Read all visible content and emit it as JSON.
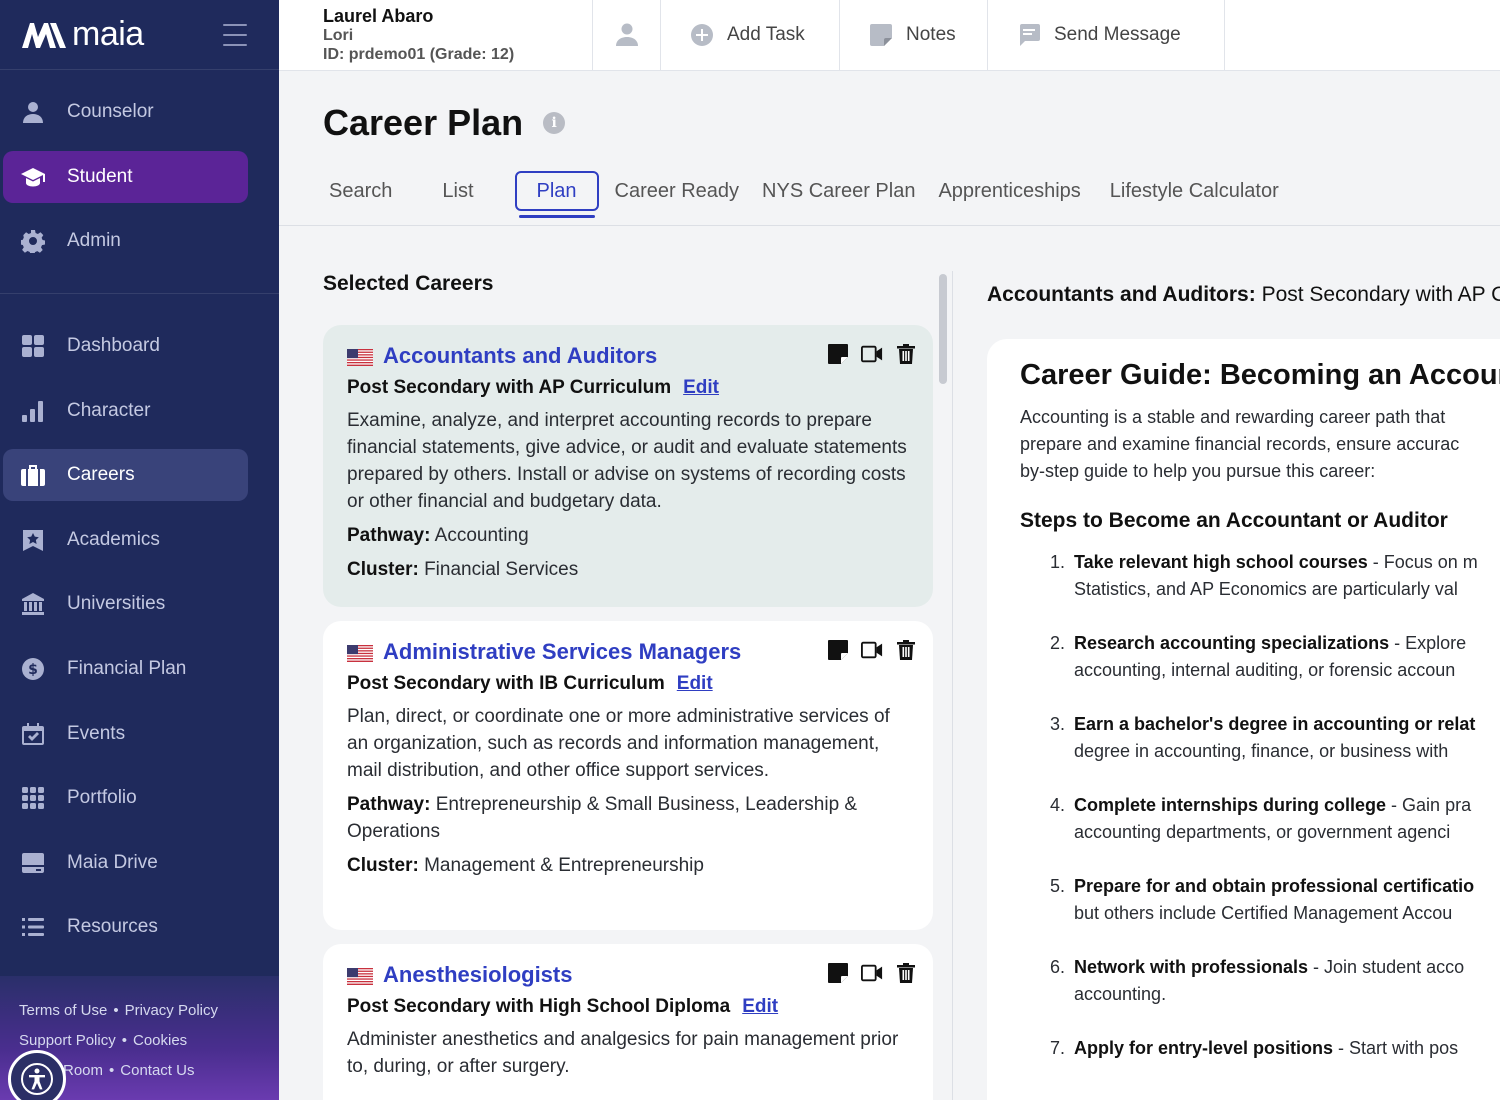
{
  "app": {
    "brand": "maia"
  },
  "sidebar": {
    "top_items": [
      {
        "label": "Counselor",
        "icon": "user-icon"
      },
      {
        "label": "Student",
        "icon": "graduation-cap-icon",
        "active": true
      },
      {
        "label": "Admin",
        "icon": "gear-icon"
      }
    ],
    "items": [
      {
        "label": "Dashboard",
        "icon": "grid-icon"
      },
      {
        "label": "Character",
        "icon": "bar-chart-icon"
      },
      {
        "label": "Careers",
        "icon": "briefcase-icon",
        "active": true
      },
      {
        "label": "Academics",
        "icon": "award-icon"
      },
      {
        "label": "Universities",
        "icon": "building-columns-icon"
      },
      {
        "label": "Financial Plan",
        "icon": "dollar-icon"
      },
      {
        "label": "Events",
        "icon": "calendar-check-icon"
      },
      {
        "label": "Portfolio",
        "icon": "dots-grid-icon"
      },
      {
        "label": "Maia Drive",
        "icon": "drive-icon"
      },
      {
        "label": "Resources",
        "icon": "list-icon"
      }
    ],
    "footer": {
      "terms": "Terms of Use",
      "privacy": "Privacy Policy",
      "support": "Support Policy",
      "cookies": "Cookies",
      "room": "Room",
      "contact": "Contact Us"
    }
  },
  "topbar": {
    "student_name": "Laurel Abaro",
    "student_nickname": "Lori",
    "student_id": "ID: prdemo01 (Grade: 12)",
    "add_task": "Add Task",
    "notes": "Notes",
    "send_message": "Send Message"
  },
  "page": {
    "title": "Career Plan",
    "tabs": [
      "Search",
      "List",
      "Plan",
      "Career Ready",
      "NYS Career Plan",
      "Apprenticeships",
      "Lifestyle Calculator"
    ],
    "active_tab": "Plan"
  },
  "selected_careers": {
    "title": "Selected Careers",
    "pathway_label": "Pathway:",
    "cluster_label": "Cluster:",
    "edit_label": "Edit",
    "cards": [
      {
        "title": "Accountants and Auditors",
        "subtitle": "Post Secondary with AP Curriculum",
        "description": "Examine, analyze, and interpret accounting records to prepare financial statements, give advice, or audit and evaluate statements prepared by others. Install or advise on systems of recording costs or other financial and budgetary data.",
        "pathway": "Accounting",
        "cluster": "Financial Services"
      },
      {
        "title": "Administrative Services Managers",
        "subtitle": "Post Secondary with IB Curriculum",
        "description": "Plan, direct, or coordinate one or more administrative services of an organization, such as records and information management, mail distribution, and other office support services.",
        "pathway": "Entrepreneurship & Small Business, Leadership & Operations",
        "cluster": "Management & Entrepreneurship"
      },
      {
        "title": "Anesthesiologists",
        "subtitle": "Post Secondary with High School Diploma",
        "description": "Administer anesthetics and analgesics for pain management prior to, during, or after surgery.",
        "pathway": "",
        "cluster": ""
      }
    ]
  },
  "guide": {
    "header_bold": "Accountants and Auditors:",
    "header_rest": " Post Secondary with AP Curriculum",
    "title": "Career Guide: Becoming an Accountant or Auditor",
    "intro_lines": [
      "Accounting is a stable and rewarding career path that",
      "prepare and examine financial records, ensure accurac",
      "by-step guide to help you pursue this career:"
    ],
    "steps_title": "Steps to Become an Accountant or Auditor",
    "steps": [
      {
        "num": "1.",
        "bold": "Take relevant high school courses",
        "line1": " - Focus on m",
        "line2": "Statistics, and AP Economics are particularly val"
      },
      {
        "num": "2.",
        "bold": "Research accounting specializations",
        "line1": " - Explore",
        "line2": "accounting, internal auditing, or forensic accoun"
      },
      {
        "num": "3.",
        "bold": "Earn a bachelor's degree in accounting or relat",
        "line1": "",
        "line2": "degree in accounting, finance, or business with"
      },
      {
        "num": "4.",
        "bold": "Complete internships during college",
        "line1": " - Gain pra",
        "line2": "accounting departments, or government agenci"
      },
      {
        "num": "5.",
        "bold": "Prepare for and obtain professional certificatio",
        "line1": "",
        "line2": "but others include Certified Management Accou"
      },
      {
        "num": "6.",
        "bold": "Network with professionals",
        "line1": " - Join student acco",
        "line2": "accounting."
      },
      {
        "num": "7.",
        "bold": "Apply for entry-level positions",
        "line1": " - Start with pos",
        "line2": ""
      }
    ]
  },
  "colors": {
    "sidebar_bg": "#1f2a5c",
    "active_purple": "#5b2497",
    "link_blue": "#2f3ec2",
    "selected_card": "#e4eceb"
  }
}
